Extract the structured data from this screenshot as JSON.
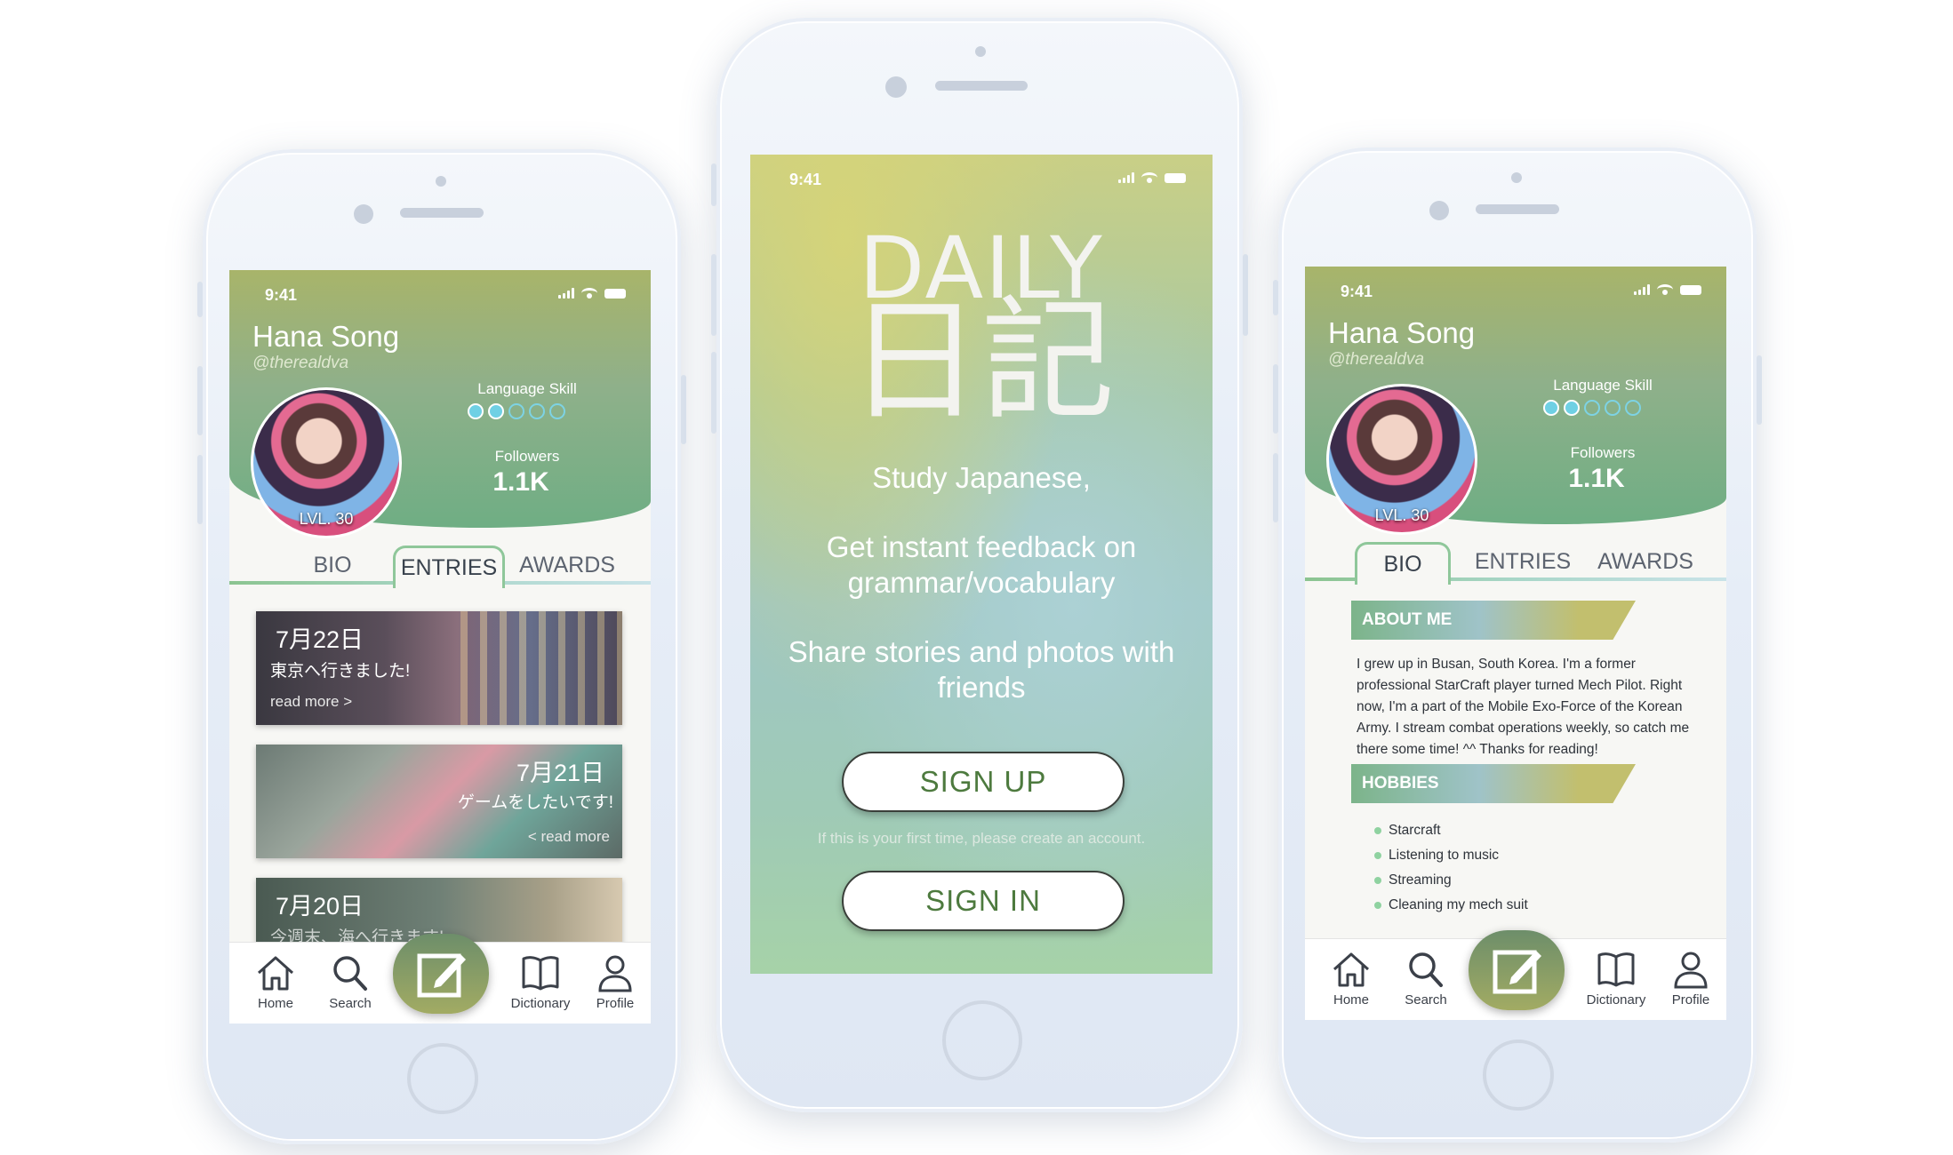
{
  "left_phone": {
    "status_time": "9:41",
    "user": {
      "name": "Hana Song",
      "handle": "@therealdva",
      "level": "LVL. 30"
    },
    "language_skill": {
      "label": "Language Skill",
      "filled": 2,
      "total": 5
    },
    "followers": {
      "label": "Followers",
      "value": "1.1K"
    },
    "tabs": [
      "BIO",
      "ENTRIES",
      "AWARDS"
    ],
    "active_tab": "ENTRIES",
    "entries": [
      {
        "date": "7月22日",
        "text": "東京へ行きました!",
        "more": "read more >"
      },
      {
        "date": "7月21日",
        "text": "ゲームをしたいです!",
        "more": "< read more"
      },
      {
        "date": "7月20日",
        "text": "今週末、海へ行きます!"
      }
    ],
    "nav": {
      "home": "Home",
      "search": "Search",
      "dictionary": "Dictionary",
      "profile": "Profile"
    }
  },
  "center_phone": {
    "status_time": "9:41",
    "logo_word": "DAILY",
    "logo_kanji": "日記",
    "taglines": [
      "Study Japanese,",
      "Get instant feedback on grammar/vocabulary",
      "Share stories and photos with friends"
    ],
    "sign_up_label": "SIGN UP",
    "sign_in_label": "SIGN IN",
    "first_time_hint": "If this is your first time, please create an account."
  },
  "right_phone": {
    "status_time": "9:41",
    "user": {
      "name": "Hana Song",
      "handle": "@therealdva",
      "level": "LVL. 30"
    },
    "language_skill": {
      "label": "Language Skill",
      "filled": 2,
      "total": 5
    },
    "followers": {
      "label": "Followers",
      "value": "1.1K"
    },
    "tabs": [
      "BIO",
      "ENTRIES",
      "AWARDS"
    ],
    "active_tab": "BIO",
    "about_title": "ABOUT ME",
    "about_text": "I grew up in Busan, South Korea. I'm a former professional StarCraft player turned  Mech Pilot. Right now, I'm a part of the Mobile Exo-Force of the Korean Army. I stream combat operations weekly, so catch me there some time! ^^ Thanks for reading!",
    "hobbies_title": "HOBBIES",
    "hobbies": [
      "Starcraft",
      "Listening to music",
      "Streaming",
      "Cleaning my mech suit"
    ],
    "nav": {
      "home": "Home",
      "search": "Search",
      "dictionary": "Dictionary",
      "profile": "Profile"
    }
  },
  "colors": {
    "header_green": "#8fb08a",
    "accent_olive": "#a8b46a",
    "skill_dot": "#6fd0e4",
    "button_text": "#4d7a3e"
  }
}
